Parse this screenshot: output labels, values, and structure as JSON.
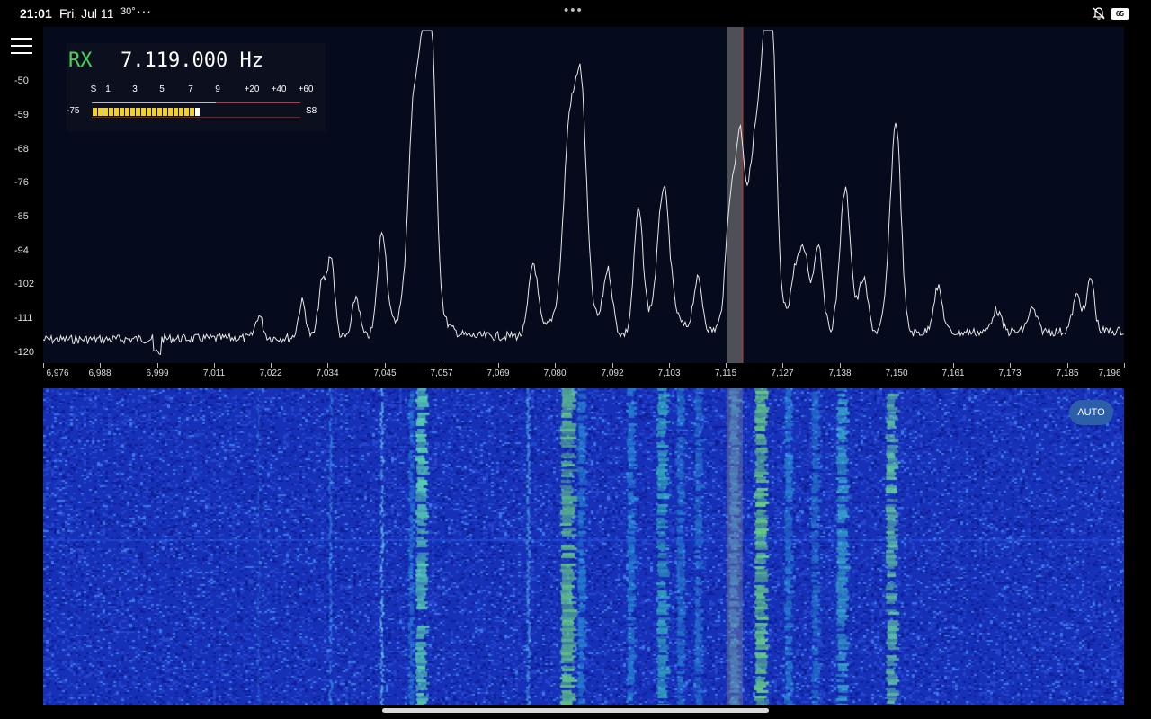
{
  "status": {
    "time": "21:01",
    "date": "Fri, Jul 11",
    "temp": "30°",
    "more": "···",
    "battery": "65"
  },
  "receiver": {
    "mode": "RX",
    "frequency": "7.119.000 Hz"
  },
  "smeter": {
    "scale": [
      "S",
      "1",
      "3",
      "5",
      "7",
      "9",
      "+20",
      "+40",
      "+60"
    ],
    "level_db": "-75",
    "reading": "S8",
    "fill_fraction": 0.53
  },
  "spectrum": {
    "y_labels": [
      "-50",
      "-59",
      "-68",
      "-76",
      "-85",
      "-94",
      "-102",
      "-111",
      "-120"
    ],
    "x_labels": [
      "6,976",
      "6,988",
      "6,999",
      "7,011",
      "7,022",
      "7,034",
      "7,045",
      "7,057",
      "7,069",
      "7,080",
      "7,092",
      "7,103",
      "7,115",
      "7,127",
      "7,138",
      "7,150",
      "7,161",
      "7,173",
      "7,185",
      "7,196"
    ],
    "colors": {
      "background": "#050a1c",
      "trace": "#e8e8e8",
      "marker": "#c0392b",
      "passband": "#8a8a8a"
    }
  },
  "waterfall": {
    "auto_label": "AUTO"
  }
}
